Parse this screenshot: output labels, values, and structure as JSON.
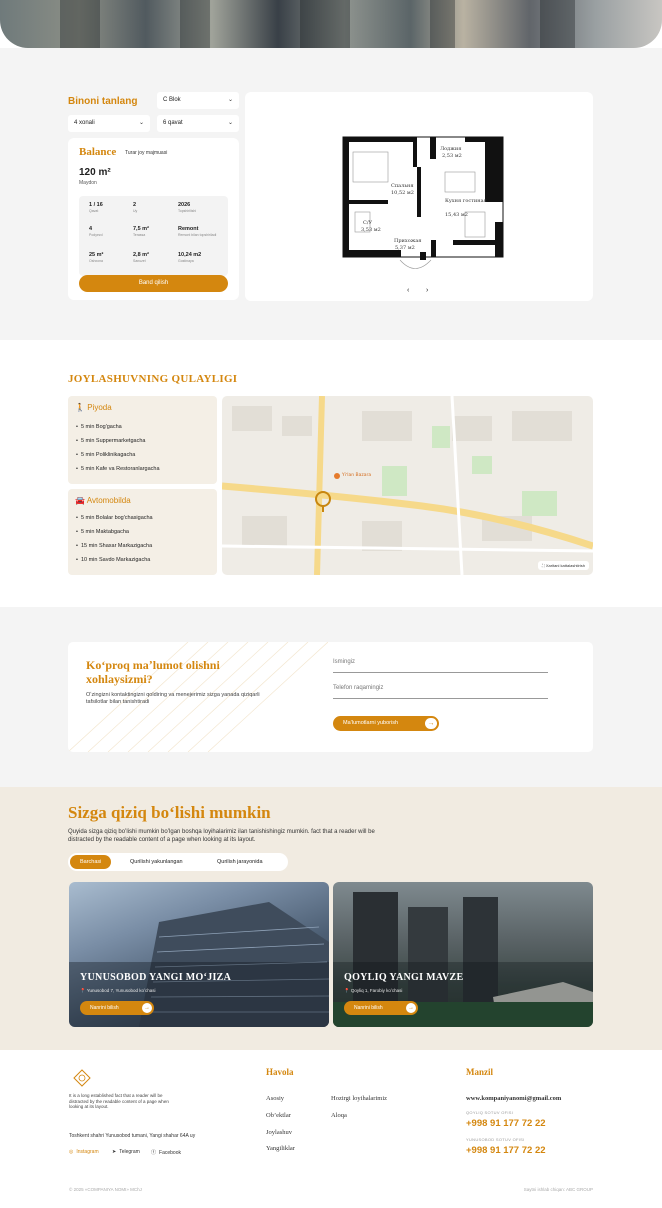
{
  "selector": {
    "title": "Binoni tanlang",
    "block": "C Blok",
    "rooms": "4 xonali",
    "floor": "6 qavat"
  },
  "apartment": {
    "name": "Balance",
    "type": "Turar joy majmuasi",
    "area": "120 m²",
    "area_label": "Maydon",
    "specs": [
      {
        "value": "1 / 16",
        "label": "Qavat"
      },
      {
        "value": "2",
        "label": "Uy"
      },
      {
        "value": "2026",
        "label": "Topshirilishi"
      },
      {
        "value": "4",
        "label": "Podyezd"
      },
      {
        "value": "7,5 m²",
        "label": "Terassa"
      },
      {
        "value": "Remont",
        "label": "Remont bilan topshiriladi"
      },
      {
        "value": "25 m²",
        "label": "Oshxona"
      },
      {
        "value": "2,8 m²",
        "label": "Sanuzel"
      },
      {
        "value": "10,24 m2",
        "label": "Gostinaya"
      }
    ],
    "book_label": "Band qilish"
  },
  "floorplan": {
    "rooms": [
      {
        "name": "Лоджия",
        "area": "2,53 м2"
      },
      {
        "name": "Спальня",
        "area": "10,52 м2"
      },
      {
        "name": "Кухня гостиная",
        "area": "15,43 м2"
      },
      {
        "name": "С/У",
        "area": "3,53 м2"
      },
      {
        "name": "Прихожая",
        "area": "5,37 м2"
      }
    ],
    "prev": "‹",
    "next": "›"
  },
  "location": {
    "title": "JOYLASHUVNING QULAYLIGI",
    "walk": {
      "label": "Piyoda",
      "icon": "walking-person-icon",
      "items": [
        "5 min Bog'gacha",
        "5 min Suppermarketgacha",
        "5 min Poliklinikagacha",
        "5 min Kafe va Restoranlargacha"
      ]
    },
    "car": {
      "label": "Avtomobilda",
      "icon": "car-icon",
      "items": [
        "5 min Bolalar bog'chasigacha",
        "5 min Maktabgacha",
        "15 min Shaxar Markazigacha",
        "10 min  Savdo Markazigacha"
      ]
    },
    "map": {
      "fullscreen_label": "Xaritani kattalashtirish",
      "poi_label": "Yiʼlan Bazarа"
    }
  },
  "contact": {
    "title": "Koʻproq maʼlumot olishni xohlaysizmi?",
    "subtitle": "Oʻzingizni kontaktingizni qoldiring va menejerimiz sizga yanada qiziqarli tafsilotlar bilan tanishtiradi",
    "name_placeholder": "Ismingiz",
    "phone_placeholder": "Telefon raqamingiz",
    "submit_label": "Maʼlumotlarni yuborish"
  },
  "projects": {
    "title": "Sizga qiziq boʻlishi mumkin",
    "description": "Quyida sizga qiziq boʻlishi mumkin boʻlgan boshqa loyihalarimiz ilan tanishishingiz mumkin. fact that a reader will be distracted by the readable content of a page when looking at its layout.",
    "tabs": [
      "Barchasi",
      "Qurilishi yakunlangan",
      "Qurilish jarayonida"
    ],
    "items": [
      {
        "name": "YUNUSOBOD YANGI MOʻJIZA",
        "address": "Yunusobod 7, Yunusobod koʻchasi",
        "more": "Nanrini bilish"
      },
      {
        "name": "QOYLIQ YANGI MAVZE",
        "address": "Qoyliq 1, Farobiy koʻchasi",
        "more": "Nanrini bilish"
      }
    ]
  },
  "footer": {
    "description": "It is a long established fact that a reader will be distracted by the readable content of a page when looking at its layout.",
    "address": "Toshkent shahri Yunusobod tumani, Yangi shahar 64A uy",
    "social": [
      "Instagram",
      "Telegram",
      "Facebook"
    ],
    "links_title": "Havola",
    "links_col1": [
      "Asosiy",
      "Obʼektlar",
      "Joylashuv",
      "Yangiliklar"
    ],
    "links_col2": [
      "Hozirgi loyihalarimiz",
      "Aloqa"
    ],
    "contact_title": "Manzil",
    "email": "www.kompaniyanomi@gmail.com",
    "offices": [
      {
        "label": "QOYLIQ SOTUV OFISI",
        "phone": "+998 91 177 72 22"
      },
      {
        "label": "YUNUSOBOD SOTUV OFISI",
        "phone": "+998 91 177 72 22"
      }
    ],
    "copyright": "© 2025 «COMPANIYA NOMI» MChJ",
    "developer": "Saytni ishlab chiqan: ABC GROUP"
  },
  "colors": {
    "accent": "#d4870f",
    "bg_gray": "#f4f4f4",
    "bg_beige": "#f1ebe1"
  }
}
